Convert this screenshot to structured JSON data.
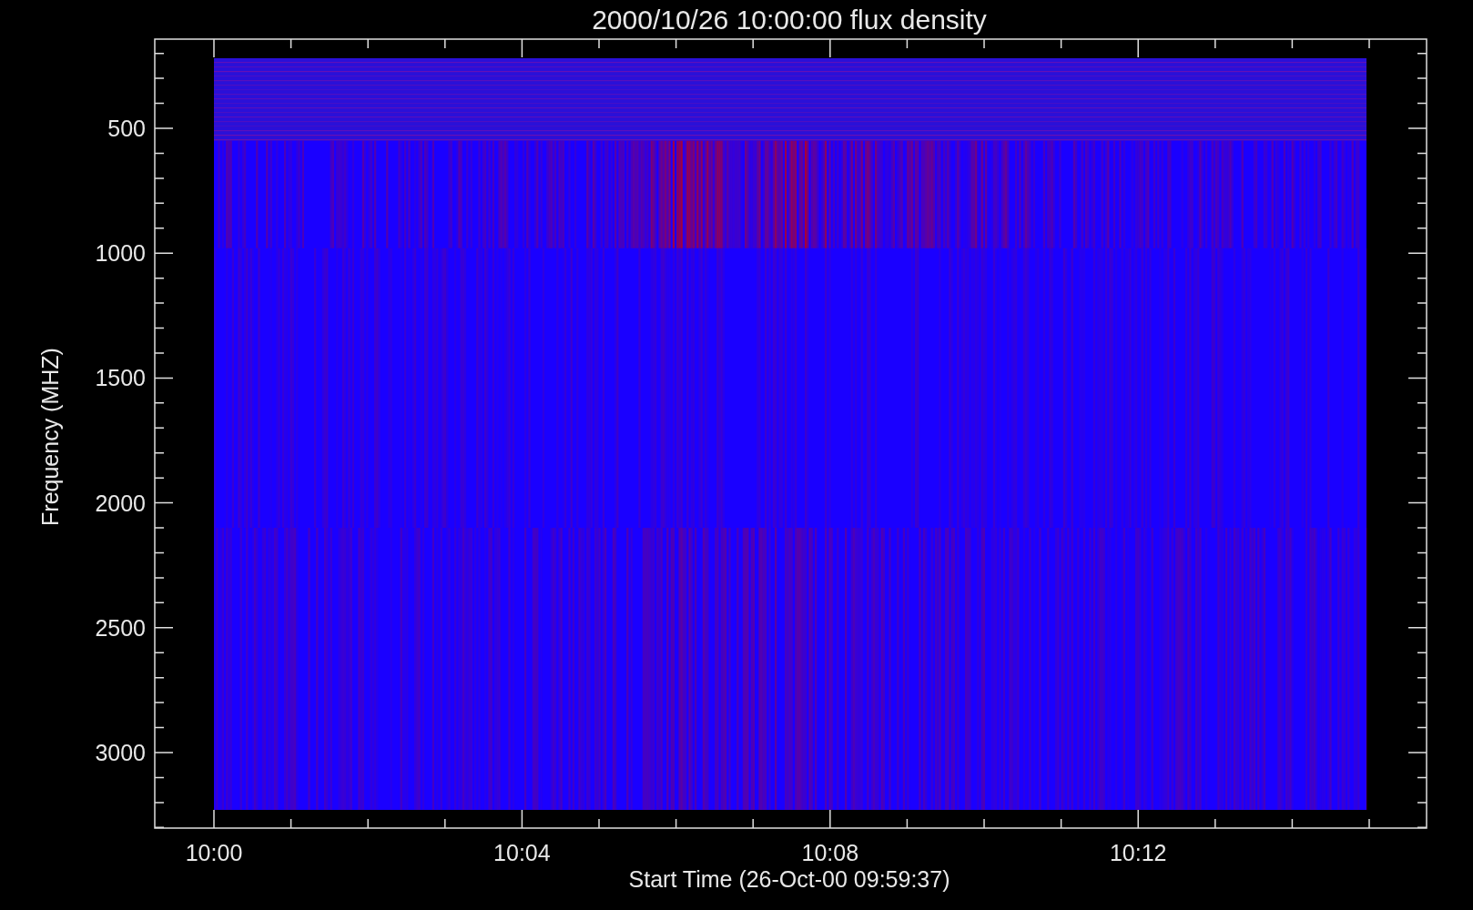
{
  "plot": {
    "title": "2000/10/26 10:00:00 flux density",
    "y_axis": {
      "label": "Frequency (MHZ)",
      "ticks": [
        "500",
        "1000",
        "1500",
        "2000",
        "2500",
        "3000"
      ]
    },
    "x_axis": {
      "label": "Start Time (26-Oct-00 09:59:37)",
      "ticks": [
        "10:00",
        "10:04",
        "10:08",
        "10:12"
      ]
    }
  }
}
